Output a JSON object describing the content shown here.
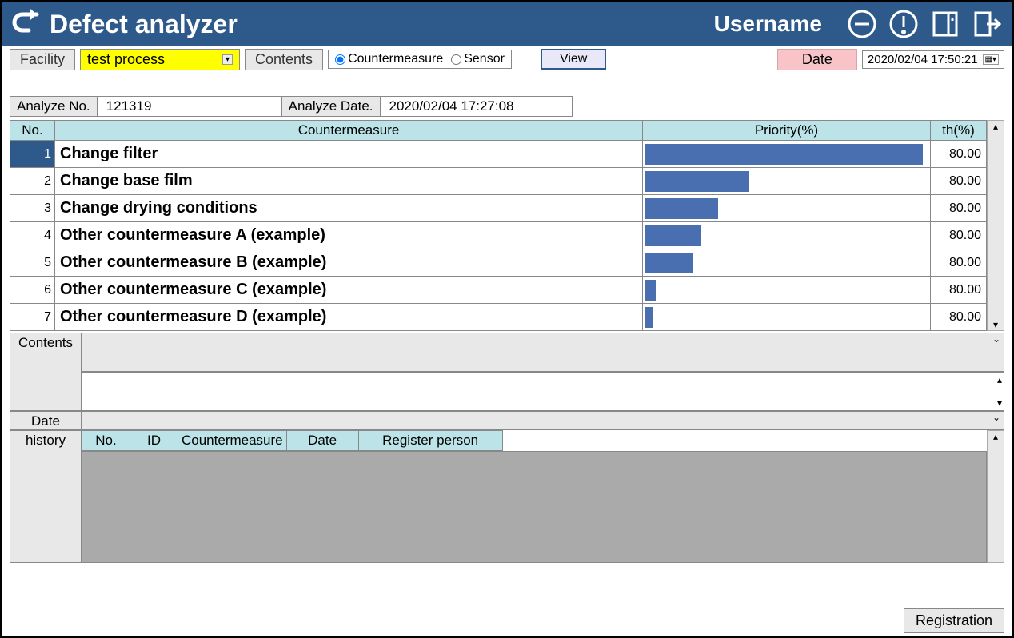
{
  "header": {
    "title": "Defect analyzer",
    "username": "Username"
  },
  "filter": {
    "facility_label": "Facility",
    "facility_value": "test process",
    "contents_label": "Contents",
    "radio_countermeasure": "Countermeasure",
    "radio_sensor": "Sensor",
    "view_label": "View",
    "date_label": "Date",
    "date_value": "2020/02/04 17:50:21"
  },
  "analyze": {
    "no_label": "Analyze No.",
    "no_value": "121319",
    "date_label": "Analyze Date.",
    "date_value": "2020/02/04 17:27:08"
  },
  "table": {
    "headers": {
      "no": "No.",
      "cm": "Countermeasure",
      "priority": "Priority(%)",
      "th": "th(%)"
    },
    "rows": [
      {
        "no": "1",
        "cm": "Change filter",
        "priority": 98,
        "th": "80.00",
        "selected": true
      },
      {
        "no": "2",
        "cm": "Change base film",
        "priority": 37,
        "th": "80.00"
      },
      {
        "no": "3",
        "cm": "Change drying conditions",
        "priority": 26,
        "th": "80.00"
      },
      {
        "no": "4",
        "cm": "Other countermeasure A (example)",
        "priority": 20,
        "th": "80.00"
      },
      {
        "no": "5",
        "cm": "Other countermeasure B (example)",
        "priority": 17,
        "th": "80.00"
      },
      {
        "no": "6",
        "cm": "Other countermeasure C (example)",
        "priority": 4,
        "th": "80.00"
      },
      {
        "no": "7",
        "cm": "Other countermeasure D (example)",
        "priority": 3,
        "th": "80.00"
      }
    ]
  },
  "panels": {
    "contents_label": "Contents",
    "date_label": "Date",
    "history_label": "history"
  },
  "history": {
    "headers": {
      "no": "No.",
      "id": "ID",
      "cm": "Countermeasure",
      "date": "Date",
      "person": "Register person"
    }
  },
  "footer": {
    "registration": "Registration"
  },
  "chart_data": {
    "type": "bar",
    "title": "Priority(%)",
    "categories": [
      "Change filter",
      "Change base film",
      "Change drying conditions",
      "Other countermeasure A (example)",
      "Other countermeasure B (example)",
      "Other countermeasure C (example)",
      "Other countermeasure D (example)"
    ],
    "values": [
      98,
      37,
      26,
      20,
      17,
      4,
      3
    ],
    "xlabel": "",
    "ylabel": "Priority(%)",
    "ylim": [
      0,
      100
    ]
  }
}
